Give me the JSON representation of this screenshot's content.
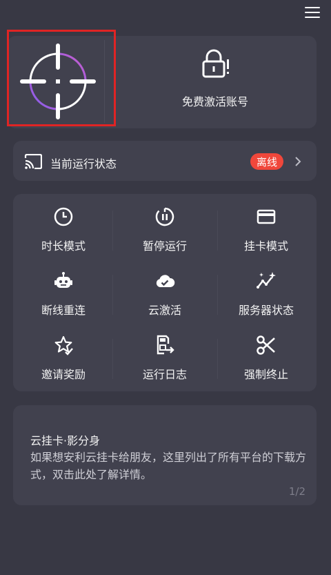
{
  "header": {
    "menu_icon": "hamburger-menu-icon"
  },
  "top": {
    "target_icon": "crosshair-target-icon",
    "activate_icon": "lock-alert-icon",
    "activate_label": "免费激活账号"
  },
  "status": {
    "icon": "cast-icon",
    "label": "当前运行状态",
    "badge": "离线",
    "badge_color": "#f0473b"
  },
  "grid": {
    "items": [
      {
        "label": "时长模式",
        "icon": "clock-icon"
      },
      {
        "label": "暂停运行",
        "icon": "pause-timer-icon"
      },
      {
        "label": "挂卡模式",
        "icon": "card-icon"
      },
      {
        "label": "断线重连",
        "icon": "robot-icon"
      },
      {
        "label": "云激活",
        "icon": "cloud-check-icon"
      },
      {
        "label": "服务器状态",
        "icon": "trend-sparkle-icon"
      },
      {
        "label": "邀请奖励",
        "icon": "star-check-icon"
      },
      {
        "label": "运行日志",
        "icon": "log-export-icon"
      },
      {
        "label": "强制终止",
        "icon": "scissors-icon"
      }
    ]
  },
  "info": {
    "title": "云挂卡·影分身",
    "body": "如果想安利云挂卡给朋友，这里列出了所有平台的下载方式，双击此处了解详情。",
    "page": "1/2"
  },
  "colors": {
    "background": "#383844",
    "card": "#41414e",
    "accent_purple": "#7b5cf0",
    "accent_pink": "#d35fc8"
  }
}
